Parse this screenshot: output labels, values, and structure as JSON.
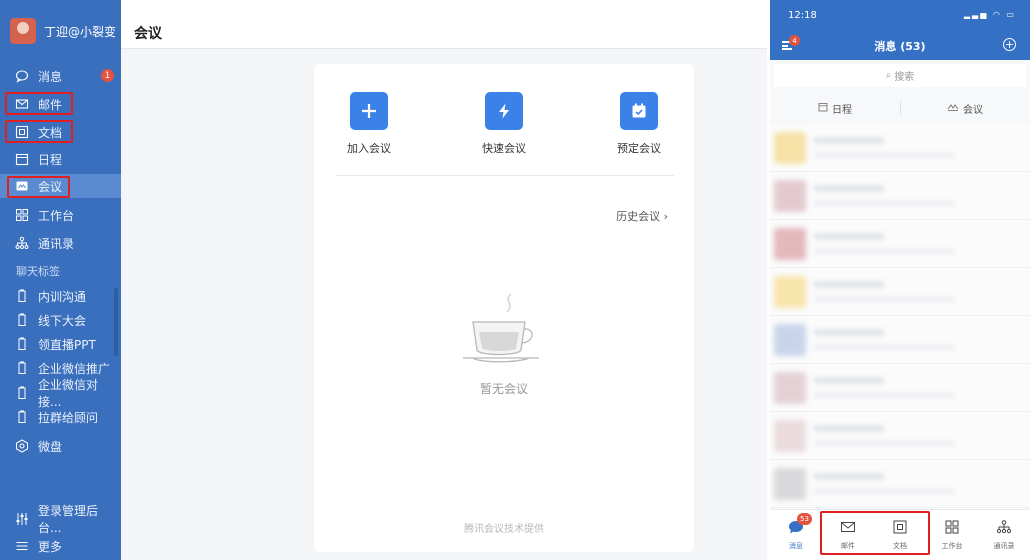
{
  "sidebar": {
    "username": "丁迎@小裂变",
    "items": [
      {
        "label": "消息",
        "icon": "chat-bubble-icon",
        "badge": "1"
      },
      {
        "label": "邮件",
        "icon": "mail-icon"
      },
      {
        "label": "文档",
        "icon": "document-icon"
      },
      {
        "label": "日程",
        "icon": "calendar-icon"
      },
      {
        "label": "会议",
        "icon": "meeting-icon",
        "active": true
      },
      {
        "label": "工作台",
        "icon": "grid-icon"
      },
      {
        "label": "通讯录",
        "icon": "org-chart-icon"
      }
    ],
    "section_label": "聊天标签",
    "tags": [
      "内训沟通",
      "线下大会",
      "领直播PPT",
      "企业微信推广",
      "企业微信对接...",
      "拉群给顾问"
    ],
    "disk": "微盘",
    "admin": "登录管理后台...",
    "more": "更多"
  },
  "main": {
    "title": "会议",
    "actions": [
      {
        "label": "加入会议",
        "icon": "plus-icon"
      },
      {
        "label": "快速会议",
        "icon": "lightning-icon"
      },
      {
        "label": "预定会议",
        "icon": "calendar-check-icon"
      }
    ],
    "history_link": "历史会议",
    "empty_text": "暂无会议",
    "footer": "腾讯会议技术提供"
  },
  "phone": {
    "time": "12:18",
    "nav_badge": "4",
    "title": "消息 (53)",
    "search_placeholder": "搜索",
    "quick": [
      "日程",
      "会议"
    ],
    "tabs": [
      {
        "label": "消息",
        "icon": "chat-bubble-icon",
        "badge": "53",
        "active": true
      },
      {
        "label": "邮件",
        "icon": "mail-icon"
      },
      {
        "label": "文档",
        "icon": "document-icon"
      },
      {
        "label": "工作台",
        "icon": "grid-icon"
      },
      {
        "label": "通讯录",
        "icon": "org-chart-icon"
      }
    ]
  },
  "colors": {
    "sidebar": "#3a6fbd",
    "accent": "#3b82e8",
    "highlight": "#e02020",
    "badge": "#e5523f"
  }
}
